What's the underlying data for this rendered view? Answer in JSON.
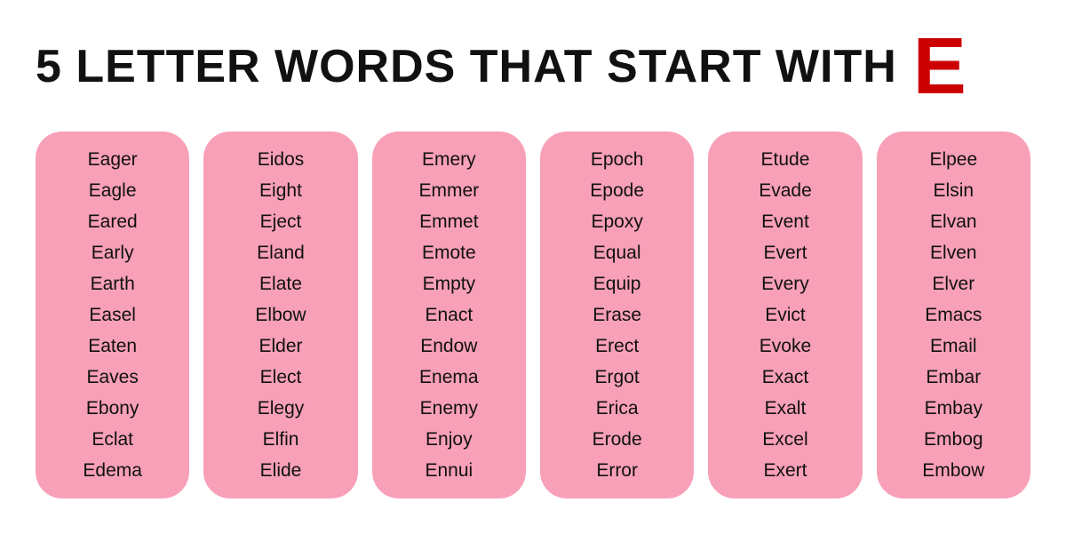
{
  "header": {
    "title": "5 LETTER WORDS THAT START WITH",
    "letter": "E"
  },
  "columns": [
    {
      "id": "col1",
      "words": [
        "Eager",
        "Eagle",
        "Eared",
        "Early",
        "Earth",
        "Easel",
        "Eaten",
        "Eaves",
        "Ebony",
        "Eclat",
        "Edema"
      ]
    },
    {
      "id": "col2",
      "words": [
        "Eidos",
        "Eight",
        "Eject",
        "Eland",
        "Elate",
        "Elbow",
        "Elder",
        "Elect",
        "Elegy",
        "Elfin",
        "Elide"
      ]
    },
    {
      "id": "col3",
      "words": [
        "Emery",
        "Emmer",
        "Emmet",
        "Emote",
        "Empty",
        "Enact",
        "Endow",
        "Enema",
        "Enemy",
        "Enjoy",
        "Ennui"
      ]
    },
    {
      "id": "col4",
      "words": [
        "Epoch",
        "Epode",
        "Epoxy",
        "Equal",
        "Equip",
        "Erase",
        "Erect",
        "Ergot",
        "Erica",
        "Erode",
        "Error"
      ]
    },
    {
      "id": "col5",
      "words": [
        "Etude",
        "Evade",
        "Event",
        "Evert",
        "Every",
        "Evict",
        "Evoke",
        "Exact",
        "Exalt",
        "Excel",
        "Exert"
      ]
    },
    {
      "id": "col6",
      "words": [
        "Elpee",
        "Elsin",
        "Elvan",
        "Elven",
        "Elver",
        "Emacs",
        "Email",
        "Embar",
        "Embay",
        "Embog",
        "Embow"
      ]
    }
  ]
}
